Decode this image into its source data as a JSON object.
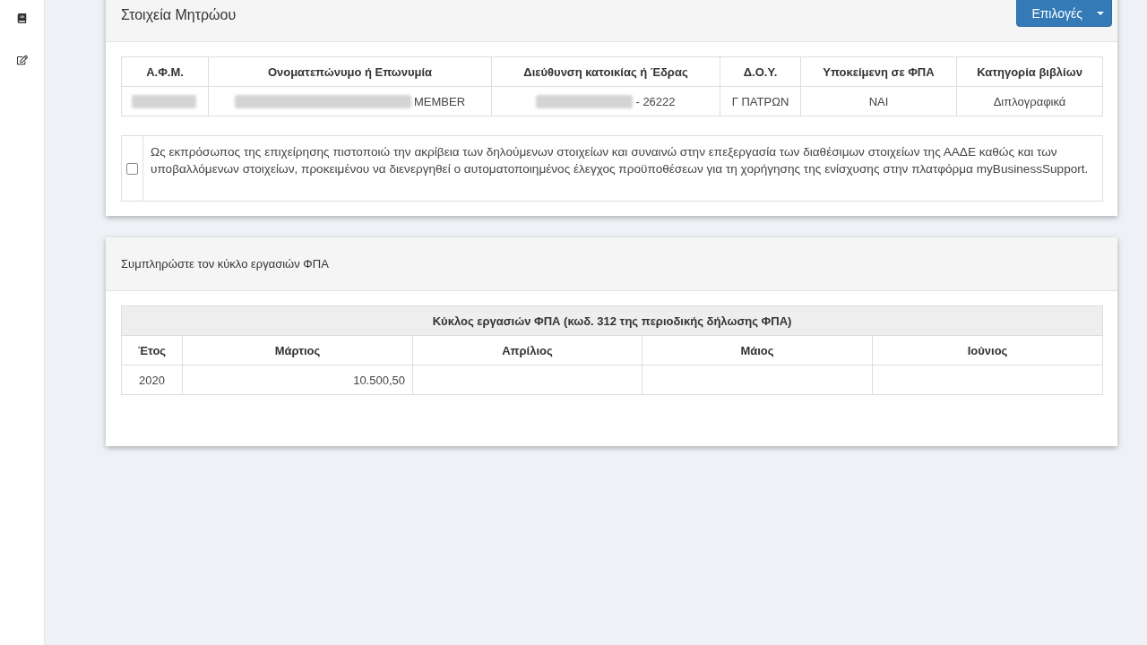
{
  "registry_panel": {
    "title": "Στοιχεία Μητρώου",
    "options_button": "Επιλογές",
    "table": {
      "columns": [
        "Α.Φ.Μ.",
        "Ονοματεπώνυμο ή Επωνυμία",
        "Διεύθυνση κατοικίας ή Έδρας",
        "Δ.Ο.Υ.",
        "Υποκείμενη σε ΦΠΑ",
        "Κατηγορία βιβλίων"
      ],
      "rows": [
        {
          "cells": [
            {
              "redacted": true
            },
            {
              "text": "MEMBER",
              "redacted": true
            },
            {
              "text": "- 26222",
              "redacted": true
            },
            {
              "text": "Γ ΠΑΤΡΩΝ",
              "redacted": false
            },
            {
              "text": "ΝΑΙ",
              "redacted": false
            },
            {
              "text": "Διπλογραφικά",
              "redacted": false
            }
          ]
        }
      ]
    },
    "declaration": {
      "checked": false,
      "text": "Ως εκπρόσωπος της επιχείρησης πιστοποιώ την ακρίβεια των δηλούμενων στοιχείων και συναινώ στην επεξεργασία των διαθέσιμων στοιχείων της ΑΑΔΕ καθώς και των υποβαλλόμενων στοιχείων, προκειμένου να διενεργηθεί ο αυτοματοποιημένος έλεγχος προϋποθέσεων για τη χορήγησης της ενίσχυσης στην πλατφόρμα myBusinessSupport."
    }
  },
  "turnover_panel": {
    "title": "Συμπληρώστε τον κύκλο εργασιών ΦΠΑ",
    "table": {
      "caption": "Κύκλος εργασιών ΦΠΑ (κωδ. 312 της περιοδικής δήλωσης ΦΠΑ)",
      "columns": [
        "Έτος",
        "Μάρτιος",
        "Απρίλιος",
        "Μάιος",
        "Ιούνιος"
      ],
      "rows": [
        {
          "cells": [
            "2020",
            "10.500,50"
          ]
        }
      ]
    }
  }
}
